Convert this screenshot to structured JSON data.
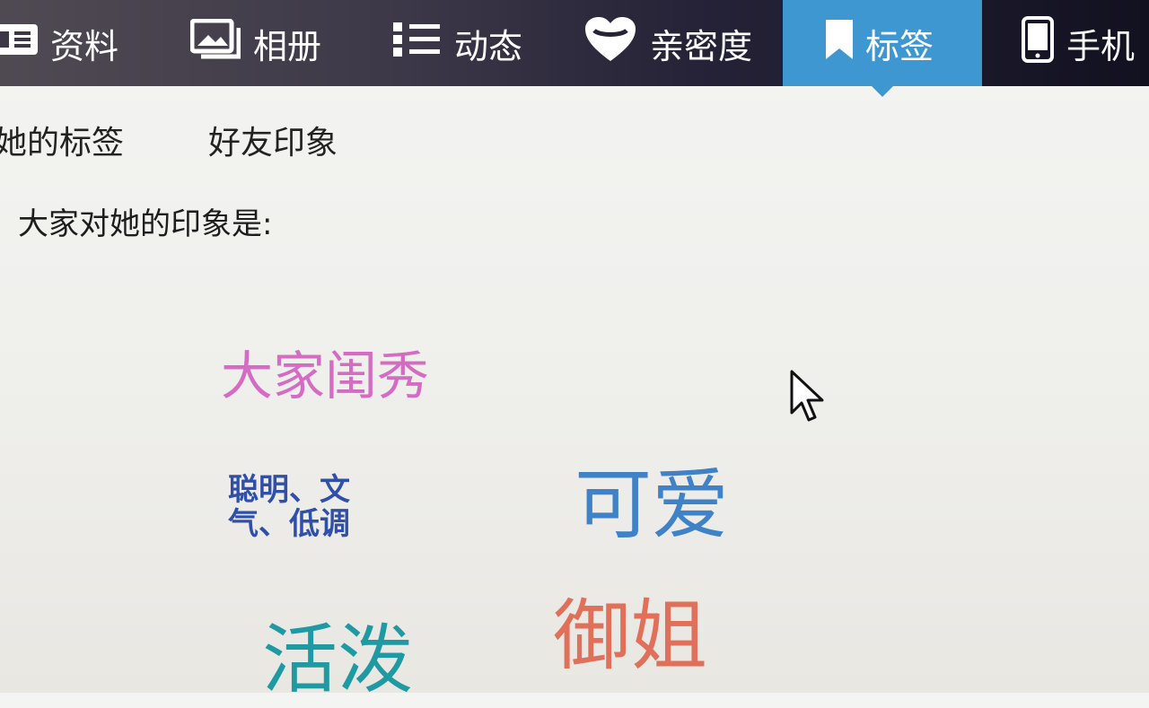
{
  "nav": {
    "tabs": [
      {
        "label": "资料",
        "icon": "profile-card-icon"
      },
      {
        "label": "相册",
        "icon": "photo-album-icon"
      },
      {
        "label": "动态",
        "icon": "list-icon"
      },
      {
        "label": "亲密度",
        "icon": "heart-icon"
      },
      {
        "label": "标签",
        "icon": "bookmark-icon",
        "active": true
      },
      {
        "label": "手机",
        "icon": "mobile-phone-icon"
      }
    ],
    "active_color": "#3f97d2"
  },
  "subtabs": [
    "她的标签",
    "好友印象"
  ],
  "intro_text": "大家对她的印象是:",
  "tags": [
    {
      "text": "大家闺秀",
      "color": "#d46cc4"
    },
    {
      "text": "聪明、文气、低调",
      "color": "#2f4fa8"
    },
    {
      "text": "可爱",
      "color": "#3f82c8"
    },
    {
      "text": "活泼",
      "color": "#1f9aa2"
    },
    {
      "text": "御姐",
      "color": "#e0705a"
    }
  ]
}
